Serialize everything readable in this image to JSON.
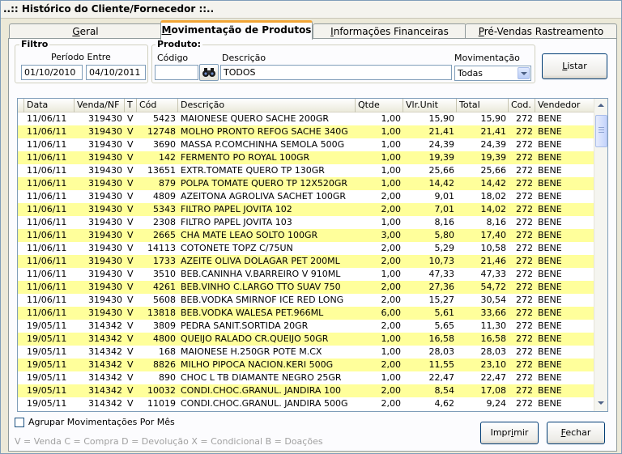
{
  "window": {
    "title": "..:: Histórico do Cliente/Fornecedor ::.."
  },
  "tabs": [
    {
      "label": "Geral",
      "ul": "G",
      "rest": "eral",
      "active": false
    },
    {
      "label": "Movimentação de Produtos",
      "ul": "M",
      "rest": "ovimentação de Produtos",
      "active": true
    },
    {
      "label": "Informações Financeiras",
      "ul": "I",
      "rest": "nformações Financeiras",
      "active": false
    },
    {
      "label": "Pré-Vendas Rastreamento",
      "ul": "P",
      "rest": "ré-Vendas Rastreamento",
      "active": false
    }
  ],
  "filtro": {
    "group_label": "Filtro",
    "periodo_label": "Período Entre",
    "date_from": "01/10/2010",
    "date_to": "04/10/2011"
  },
  "produto": {
    "group_label": "Produto:",
    "codigo_label": "Código",
    "codigo_value": "",
    "descricao_label": "Descrição",
    "descricao_value": "TODOS",
    "movimentacao_label": "Movimentação",
    "movimentacao_value": "Todas"
  },
  "buttons": {
    "listar": {
      "ul": "L",
      "rest": "istar"
    },
    "imprimir": {
      "pre": "Impr",
      "ul": "i",
      "rest": "mir"
    },
    "fechar": {
      "ul": "F",
      "rest": "echar"
    }
  },
  "grid": {
    "columns": [
      "Data",
      "Venda/NF",
      "T",
      "Cód",
      "Descrição",
      "Qtde",
      "Vlr.Unit",
      "Total",
      "Cod.",
      "Vendedor"
    ],
    "rows": [
      [
        "11/06/11",
        "319430",
        "V",
        "5423",
        "MAIONESE QUERO SACHE 200GR",
        "1,00",
        "15,90",
        "15,90",
        "272",
        "BENE"
      ],
      [
        "11/06/11",
        "319430",
        "V",
        "12748",
        "MOLHO PRONTO REFOG SACHE 340G",
        "1,00",
        "21,41",
        "21,41",
        "272",
        "BENE"
      ],
      [
        "11/06/11",
        "319430",
        "V",
        "3690",
        "MASSA P.COMCHINHA SEMOLA 500G",
        "1,00",
        "24,39",
        "24,39",
        "272",
        "BENE"
      ],
      [
        "11/06/11",
        "319430",
        "V",
        "142",
        "FERMENTO PO ROYAL 100GR",
        "1,00",
        "19,39",
        "19,39",
        "272",
        "BENE"
      ],
      [
        "11/06/11",
        "319430",
        "V",
        "13651",
        "EXTR.TOMATE QUERO TP 130GR",
        "1,00",
        "25,66",
        "25,66",
        "272",
        "BENE"
      ],
      [
        "11/06/11",
        "319430",
        "V",
        "879",
        "POLPA TOMATE QUERO TP 12X520GR",
        "1,00",
        "14,42",
        "14,42",
        "272",
        "BENE"
      ],
      [
        "11/06/11",
        "319430",
        "V",
        "4809",
        "AZEITONA AGROLIVA SACHET 100GR",
        "2,00",
        "9,01",
        "18,02",
        "272",
        "BENE"
      ],
      [
        "11/06/11",
        "319430",
        "V",
        "5343",
        "FILTRO PAPEL JOVITA 102",
        "2,00",
        "7,01",
        "14,02",
        "272",
        "BENE"
      ],
      [
        "11/06/11",
        "319430",
        "V",
        "2308",
        "FILTRO PAPEL JOVITA 103",
        "1,00",
        "8,16",
        "8,16",
        "272",
        "BENE"
      ],
      [
        "11/06/11",
        "319430",
        "V",
        "2665",
        "CHA MATE LEAO SOLTO 100GR",
        "3,00",
        "5,80",
        "17,40",
        "272",
        "BENE"
      ],
      [
        "11/06/11",
        "319430",
        "V",
        "14113",
        "COTONETE TOPZ C/75UN",
        "2,00",
        "5,29",
        "10,58",
        "272",
        "BENE"
      ],
      [
        "11/06/11",
        "319430",
        "V",
        "1733",
        "AZEITE OLIVA DOLAGAR PET 200ML",
        "2,00",
        "10,73",
        "21,46",
        "272",
        "BENE"
      ],
      [
        "11/06/11",
        "319430",
        "V",
        "3510",
        "BEB.CANINHA V.BARREIRO V 910ML",
        "1,00",
        "47,33",
        "47,33",
        "272",
        "BENE"
      ],
      [
        "11/06/11",
        "319430",
        "V",
        "4261",
        "BEB.VINHO C.LARGO TTO SUAV 750",
        "2,00",
        "27,36",
        "54,72",
        "272",
        "BENE"
      ],
      [
        "11/06/11",
        "319430",
        "V",
        "5608",
        "BEB.VODKA SMIRNOF ICE RED LONG",
        "2,00",
        "15,27",
        "30,54",
        "272",
        "BENE"
      ],
      [
        "11/06/11",
        "319430",
        "V",
        "13818",
        "BEB.VODKA WALESA PET.966ML",
        "6,00",
        "5,61",
        "33,66",
        "272",
        "BENE"
      ],
      [
        "19/05/11",
        "314342",
        "V",
        "3809",
        "PEDRA SANIT.SORTIDA 20GR",
        "2,00",
        "5,65",
        "11,30",
        "272",
        "BENE"
      ],
      [
        "19/05/11",
        "314342",
        "V",
        "4800",
        "QUEIJO RALADO CR.QUEIJO 50GR",
        "1,00",
        "16,58",
        "16,58",
        "272",
        "BENE"
      ],
      [
        "19/05/11",
        "314342",
        "V",
        "168",
        "MAIONESE H.250GR POTE M.CX",
        "1,00",
        "28,03",
        "28,03",
        "272",
        "BENE"
      ],
      [
        "19/05/11",
        "314342",
        "V",
        "8826",
        "MILHO PIPOCA NACION.KERI 500G",
        "2,00",
        "11,55",
        "23,10",
        "272",
        "BENE"
      ],
      [
        "19/05/11",
        "314342",
        "V",
        "890",
        "CHOC L TB DIAMANTE NEGRO 25GR",
        "1,00",
        "22,47",
        "22,47",
        "272",
        "BENE"
      ],
      [
        "19/05/11",
        "314342",
        "V",
        "10032",
        "CONDI.CHOC.GRANUL. JANDIRA 100",
        "2,00",
        "8,54",
        "17,08",
        "272",
        "BENE"
      ],
      [
        "19/05/11",
        "314342",
        "V",
        "11019",
        "CONDI.CHOC.GRANUL. JANDIRA 500G",
        "2,00",
        "4,62",
        "9,24",
        "272",
        "BENE"
      ]
    ]
  },
  "agrupar_label": "Agrupar Movimentações Por Mês",
  "legend": "V = Venda    C = Compra   D = Devolução   X = Condicional    B = Doações",
  "colors": {
    "highlight_row": "#ffff9b",
    "tab_accent": "#f2a535",
    "border": "#7f9db9"
  },
  "icons": {
    "search": "binoculars-icon"
  }
}
